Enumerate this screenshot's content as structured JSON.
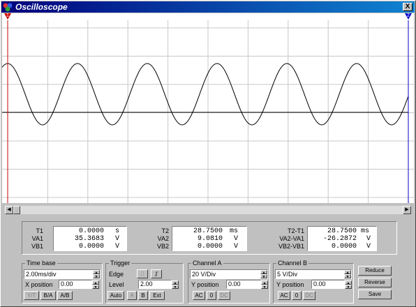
{
  "window": {
    "title": "Oscilloscope",
    "close_label": "X"
  },
  "markers": {
    "left": "1",
    "right": "2"
  },
  "readout": {
    "t1": {
      "label": "T1",
      "value": "0.0000",
      "unit": "s"
    },
    "va1": {
      "label": "VA1",
      "value": "35.3683",
      "unit": "V"
    },
    "vb1": {
      "label": "VB1",
      "value": "0.0000",
      "unit": "V"
    },
    "t2": {
      "label": "T2",
      "value": "28.7500",
      "unit": "ms"
    },
    "va2": {
      "label": "VA2",
      "value": "9.0810",
      "unit": "V"
    },
    "vb2": {
      "label": "VB2",
      "value": "0.0000",
      "unit": "V"
    },
    "t2t1": {
      "label": "T2-T1",
      "value": "28.7500",
      "unit": "ms"
    },
    "va2va1": {
      "label": "VA2-VA1",
      "value": "-26.2872",
      "unit": "V"
    },
    "vb2vb1": {
      "label": "VB2-VB1",
      "value": "0.0000",
      "unit": "V"
    }
  },
  "timebase": {
    "title": "Time base",
    "scale": "2.00ms/div",
    "xpos_label": "X position",
    "xpos": "0.00",
    "yt": "Y/T",
    "ba": "B/A",
    "ab": "A/B"
  },
  "trigger": {
    "title": "Trigger",
    "edge_label": "Edge",
    "level_label": "Level",
    "level": "2.00",
    "auto": "Auto",
    "a": "A",
    "b": "B",
    "ext": "Ext"
  },
  "channel_a": {
    "title": "Channel A",
    "scale": "20 V/Div",
    "ypos_label": "Y position",
    "ypos": "0.00",
    "ac": "AC",
    "zero": "0",
    "dc": "DC"
  },
  "channel_b": {
    "title": "Channel B",
    "scale": "5 V/Div",
    "ypos_label": "Y position",
    "ypos": "0.00",
    "ac": "AC",
    "zero": "0",
    "dc": "DC"
  },
  "buttons": {
    "reduce": "Reduce",
    "reverse": "Reverse",
    "save": "Save"
  },
  "colors": {
    "grid": "#c8c8c8",
    "trace": "#000000",
    "cursor1": "#cc0000",
    "cursor2": "#0000cc"
  }
}
